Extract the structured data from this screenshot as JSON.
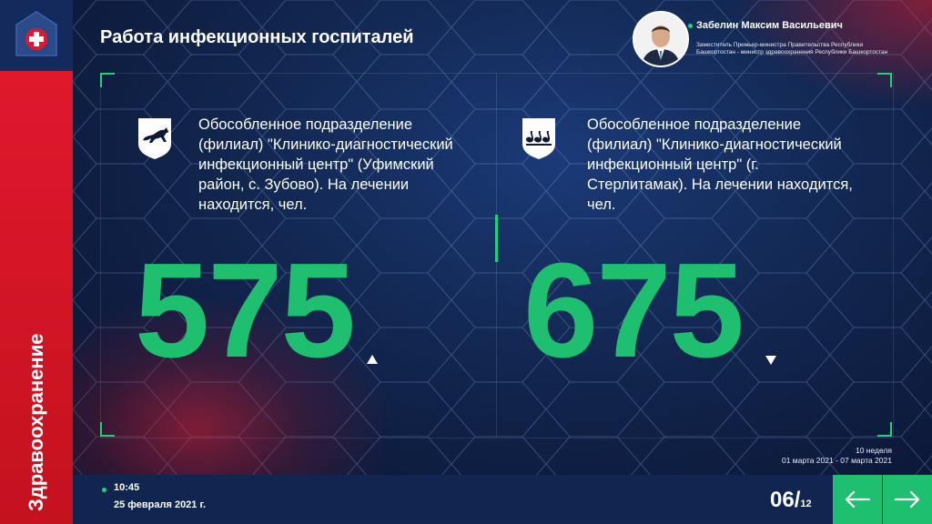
{
  "header": {
    "title": "Работа инфекционных госпиталей"
  },
  "sidebar": {
    "title": "Здравоохранение"
  },
  "person": {
    "name": "Забелин Максим Васильевич",
    "role": "Заместитель Премьер-министра Правительства Республики Башкортостан - министр здравоохранения Республики Башкортостан"
  },
  "hospitals": [
    {
      "description": "Обособленное подразделение (филиал) \"Клинико-диагностический инфекционный центр\" (Уфимский район, с. Зубово). На лечении находится, чел.",
      "count": "575",
      "trend": "up",
      "emblem": "marten-emblem-icon"
    },
    {
      "description": "Обособленное подразделение (филиал) \"Клинико-диагностический инфекционный центр\" (г. Стерлитамак). На лечении находится, чел.",
      "count": "675",
      "trend": "down",
      "emblem": "swans-emblem-icon"
    }
  ],
  "period": {
    "week": "10 неделя",
    "range": "01 марта 2021 - 07 марта 2021"
  },
  "footer": {
    "time": "10:45",
    "date": "25 февраля 2021 г.",
    "page_current": "06/",
    "page_total": "12"
  },
  "colors": {
    "accent": "#1fbf70",
    "sidebar": "#e0182d",
    "background": "#12264f"
  }
}
